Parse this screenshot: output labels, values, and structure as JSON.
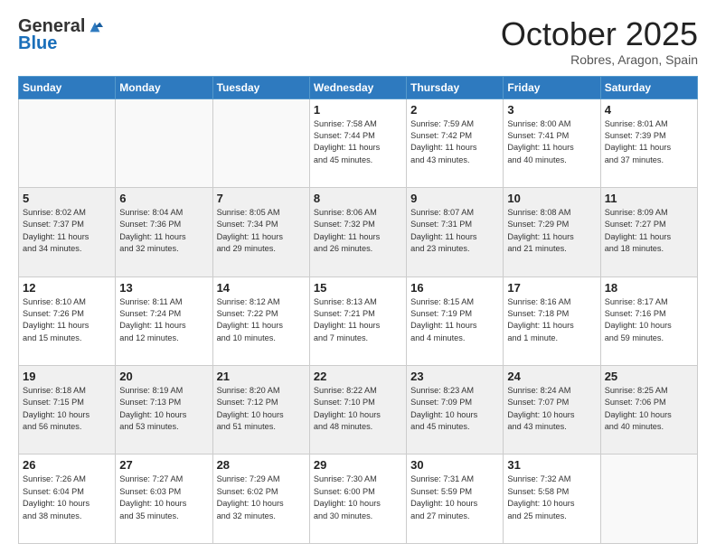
{
  "logo": {
    "general": "General",
    "blue": "Blue"
  },
  "header": {
    "month": "October 2025",
    "location": "Robres, Aragon, Spain"
  },
  "weekdays": [
    "Sunday",
    "Monday",
    "Tuesday",
    "Wednesday",
    "Thursday",
    "Friday",
    "Saturday"
  ],
  "weeks": [
    [
      {
        "day": "",
        "info": ""
      },
      {
        "day": "",
        "info": ""
      },
      {
        "day": "",
        "info": ""
      },
      {
        "day": "1",
        "info": "Sunrise: 7:58 AM\nSunset: 7:44 PM\nDaylight: 11 hours\nand 45 minutes."
      },
      {
        "day": "2",
        "info": "Sunrise: 7:59 AM\nSunset: 7:42 PM\nDaylight: 11 hours\nand 43 minutes."
      },
      {
        "day": "3",
        "info": "Sunrise: 8:00 AM\nSunset: 7:41 PM\nDaylight: 11 hours\nand 40 minutes."
      },
      {
        "day": "4",
        "info": "Sunrise: 8:01 AM\nSunset: 7:39 PM\nDaylight: 11 hours\nand 37 minutes."
      }
    ],
    [
      {
        "day": "5",
        "info": "Sunrise: 8:02 AM\nSunset: 7:37 PM\nDaylight: 11 hours\nand 34 minutes."
      },
      {
        "day": "6",
        "info": "Sunrise: 8:04 AM\nSunset: 7:36 PM\nDaylight: 11 hours\nand 32 minutes."
      },
      {
        "day": "7",
        "info": "Sunrise: 8:05 AM\nSunset: 7:34 PM\nDaylight: 11 hours\nand 29 minutes."
      },
      {
        "day": "8",
        "info": "Sunrise: 8:06 AM\nSunset: 7:32 PM\nDaylight: 11 hours\nand 26 minutes."
      },
      {
        "day": "9",
        "info": "Sunrise: 8:07 AM\nSunset: 7:31 PM\nDaylight: 11 hours\nand 23 minutes."
      },
      {
        "day": "10",
        "info": "Sunrise: 8:08 AM\nSunset: 7:29 PM\nDaylight: 11 hours\nand 21 minutes."
      },
      {
        "day": "11",
        "info": "Sunrise: 8:09 AM\nSunset: 7:27 PM\nDaylight: 11 hours\nand 18 minutes."
      }
    ],
    [
      {
        "day": "12",
        "info": "Sunrise: 8:10 AM\nSunset: 7:26 PM\nDaylight: 11 hours\nand 15 minutes."
      },
      {
        "day": "13",
        "info": "Sunrise: 8:11 AM\nSunset: 7:24 PM\nDaylight: 11 hours\nand 12 minutes."
      },
      {
        "day": "14",
        "info": "Sunrise: 8:12 AM\nSunset: 7:22 PM\nDaylight: 11 hours\nand 10 minutes."
      },
      {
        "day": "15",
        "info": "Sunrise: 8:13 AM\nSunset: 7:21 PM\nDaylight: 11 hours\nand 7 minutes."
      },
      {
        "day": "16",
        "info": "Sunrise: 8:15 AM\nSunset: 7:19 PM\nDaylight: 11 hours\nand 4 minutes."
      },
      {
        "day": "17",
        "info": "Sunrise: 8:16 AM\nSunset: 7:18 PM\nDaylight: 11 hours\nand 1 minute."
      },
      {
        "day": "18",
        "info": "Sunrise: 8:17 AM\nSunset: 7:16 PM\nDaylight: 10 hours\nand 59 minutes."
      }
    ],
    [
      {
        "day": "19",
        "info": "Sunrise: 8:18 AM\nSunset: 7:15 PM\nDaylight: 10 hours\nand 56 minutes."
      },
      {
        "day": "20",
        "info": "Sunrise: 8:19 AM\nSunset: 7:13 PM\nDaylight: 10 hours\nand 53 minutes."
      },
      {
        "day": "21",
        "info": "Sunrise: 8:20 AM\nSunset: 7:12 PM\nDaylight: 10 hours\nand 51 minutes."
      },
      {
        "day": "22",
        "info": "Sunrise: 8:22 AM\nSunset: 7:10 PM\nDaylight: 10 hours\nand 48 minutes."
      },
      {
        "day": "23",
        "info": "Sunrise: 8:23 AM\nSunset: 7:09 PM\nDaylight: 10 hours\nand 45 minutes."
      },
      {
        "day": "24",
        "info": "Sunrise: 8:24 AM\nSunset: 7:07 PM\nDaylight: 10 hours\nand 43 minutes."
      },
      {
        "day": "25",
        "info": "Sunrise: 8:25 AM\nSunset: 7:06 PM\nDaylight: 10 hours\nand 40 minutes."
      }
    ],
    [
      {
        "day": "26",
        "info": "Sunrise: 7:26 AM\nSunset: 6:04 PM\nDaylight: 10 hours\nand 38 minutes."
      },
      {
        "day": "27",
        "info": "Sunrise: 7:27 AM\nSunset: 6:03 PM\nDaylight: 10 hours\nand 35 minutes."
      },
      {
        "day": "28",
        "info": "Sunrise: 7:29 AM\nSunset: 6:02 PM\nDaylight: 10 hours\nand 32 minutes."
      },
      {
        "day": "29",
        "info": "Sunrise: 7:30 AM\nSunset: 6:00 PM\nDaylight: 10 hours\nand 30 minutes."
      },
      {
        "day": "30",
        "info": "Sunrise: 7:31 AM\nSunset: 5:59 PM\nDaylight: 10 hours\nand 27 minutes."
      },
      {
        "day": "31",
        "info": "Sunrise: 7:32 AM\nSunset: 5:58 PM\nDaylight: 10 hours\nand 25 minutes."
      },
      {
        "day": "",
        "info": ""
      }
    ]
  ]
}
